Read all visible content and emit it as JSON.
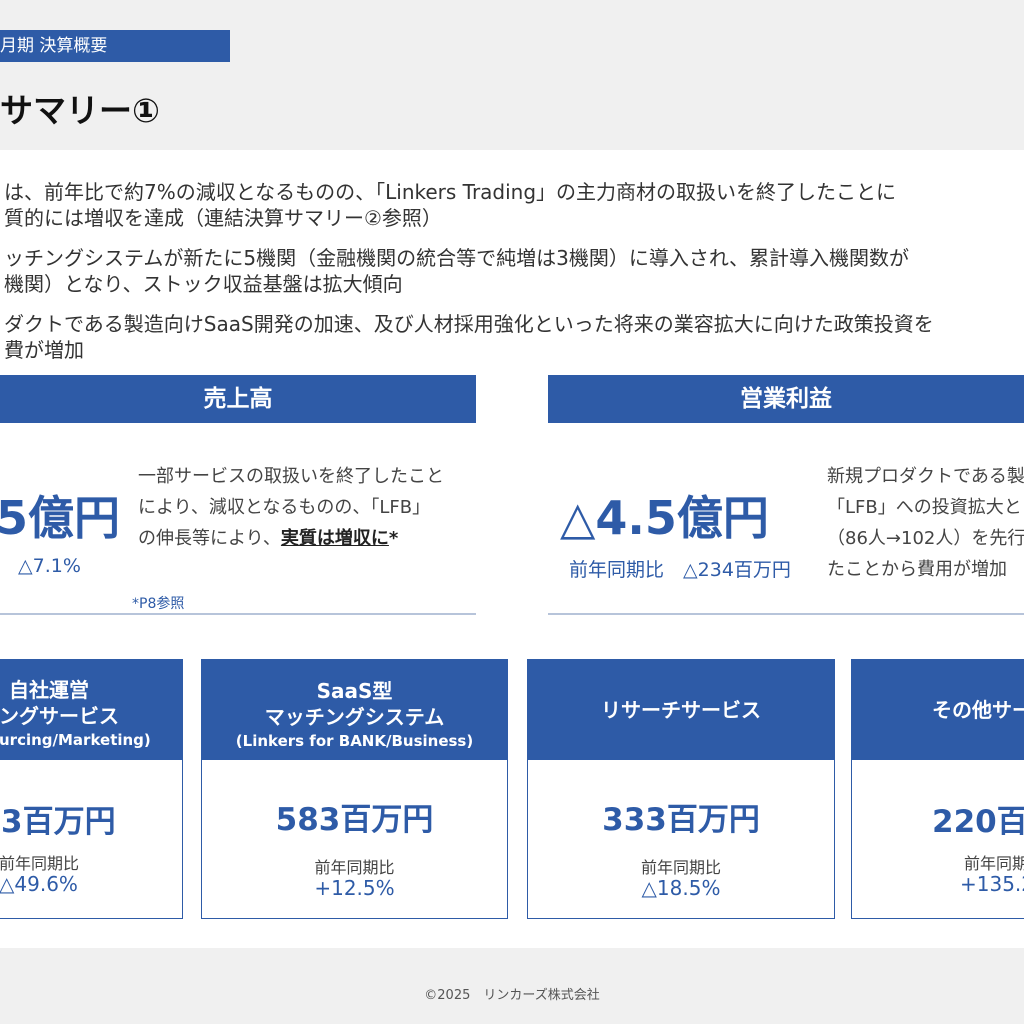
{
  "header": {
    "tag": "月期 決算概要",
    "title": "サマリー①"
  },
  "bullets": [
    "は、前年比で約7%の減収となるものの、「Linkers Trading」の主力商材の取扱いを終了したことに",
    "質的には増収を達成（連結決算サマリー②参照）",
    "ッチングシステムが新たに5機関（金融機関の統合等で純増は3機関）に導入され、累計導入機関数が",
    "機関）となり、ストック収益基盤は拡大傾向",
    "ダクトである製造向けSaaS開発の加速、及び人材採用強化といった将来の業容拡大に向けた政策投資を",
    "費が増加"
  ],
  "sales": {
    "header": "売上高",
    "value": "5億円",
    "change": "△7.1%",
    "desc_lines": [
      "一部サービスの取扱いを終了したこと",
      "により、減収となるものの、「LFB」"
    ],
    "desc_line3_prefix": "の伸長等により、",
    "desc_line3_bold": "実質は増収に",
    "desc_line3_suffix": "*",
    "note": "*P8参照"
  },
  "operating_profit": {
    "header": "営業利益",
    "value": "△4.5億円",
    "change_label": "前年同期比",
    "change_value": "△234百万円",
    "desc_lines": [
      "新規プロダクトである製",
      "「LFB」への投資拡大と",
      "（86人→102人）を先行",
      "たことから費用が増加"
    ]
  },
  "cards": [
    {
      "title_line1": "自社運営",
      "title_line2": "ングサービス",
      "title_line3": "urcing/Marketing)",
      "value": "3百万円",
      "sub_label": "前年同期比",
      "pct": "△49.6%"
    },
    {
      "title_line1": "SaaS型",
      "title_line2": "マッチングシステム",
      "title_line3": "(Linkers for BANK/Business)",
      "value": "583百万円",
      "sub_label": "前年同期比",
      "pct": "+12.5%"
    },
    {
      "title_line1": "",
      "title_line2": "リサーチサービス",
      "title_line3": "",
      "value": "333百万円",
      "sub_label": "前年同期比",
      "pct": "△18.5%"
    },
    {
      "title_line1": "",
      "title_line2": "その他サー",
      "title_line3": "",
      "value": "220百",
      "sub_label": "前年同期",
      "pct": "+135.2"
    }
  ],
  "footer": "©2025　リンカーズ株式会社"
}
